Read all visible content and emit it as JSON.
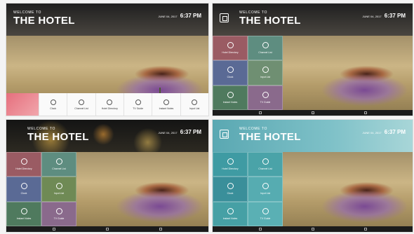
{
  "screens": [
    {
      "id": "bottom-bar-layout",
      "welcome": "WELCOME TO",
      "hotel": "THE HOTEL",
      "date": "JUNE 04, 2017",
      "time": "6:37 PM",
      "menu": [
        {
          "label": "Clock",
          "icon": "clock-icon"
        },
        {
          "label": "Channel List",
          "icon": "tv-icon"
        },
        {
          "label": "Hotel Directory",
          "icon": "book-icon"
        },
        {
          "label": "TV Guide",
          "icon": "guide-icon"
        },
        {
          "label": "Instant Notes",
          "icon": "chat-icon"
        },
        {
          "label": "Input List",
          "icon": "input-icon"
        }
      ]
    },
    {
      "id": "dark-grid-layout",
      "welcome": "WELCOME TO",
      "hotel": "THE HOTEL",
      "date": "JUNE 04, 2017",
      "time": "6:37 PM",
      "tiles": [
        {
          "label": "Hotel Directory",
          "color": "#9a5b63"
        },
        {
          "label": "Channel List",
          "color": "#5e8d80"
        },
        {
          "label": "Clock",
          "color": "#5a6a95"
        },
        {
          "label": "Input List",
          "color": "#6f8f72"
        },
        {
          "label": "Instant Notes",
          "color": "#4f7a5e"
        },
        {
          "label": "TV Guide",
          "color": "#8a6a8c"
        }
      ]
    },
    {
      "id": "night-grid-layout",
      "welcome": "WELCOME TO",
      "hotel": "THE HOTEL",
      "date": "JUNE 04, 2017",
      "time": "6:37 PM",
      "tiles": [
        {
          "label": "Hotel Directory",
          "color": "#9a5b63"
        },
        {
          "label": "Channel List",
          "color": "#5e8d80"
        },
        {
          "label": "Clock",
          "color": "#5a6a95"
        },
        {
          "label": "Input List",
          "color": "#6f8a55"
        },
        {
          "label": "Instant Notes",
          "color": "#4f7a5e"
        },
        {
          "label": "TV Guide",
          "color": "#8a6a8c"
        }
      ]
    },
    {
      "id": "teal-grid-layout",
      "welcome": "WELCOME TO",
      "hotel": "THE HOTEL",
      "date": "JUNE 04, 2017",
      "time": "6:37 PM",
      "tiles": [
        {
          "label": "Hotel Directory",
          "color": "#3f9ba3"
        },
        {
          "label": "Channel List",
          "color": "#4aa3a8"
        },
        {
          "label": "Clock",
          "color": "#3a8f9a"
        },
        {
          "label": "Input List",
          "color": "#56acb1"
        },
        {
          "label": "Instant Notes",
          "color": "#46a0a5"
        },
        {
          "label": "TV Guide",
          "color": "#5ab0b4"
        }
      ]
    }
  ]
}
